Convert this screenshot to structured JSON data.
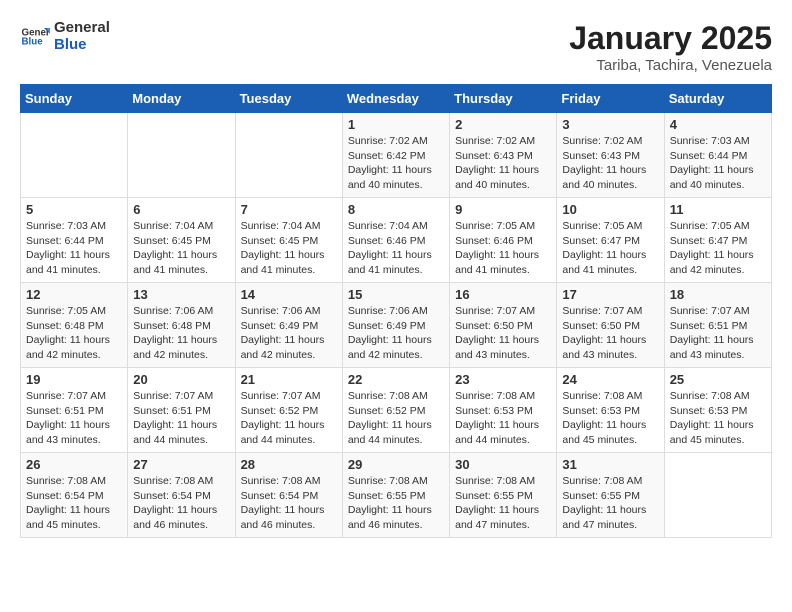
{
  "header": {
    "logo_general": "General",
    "logo_blue": "Blue",
    "title": "January 2025",
    "subtitle": "Tariba, Tachira, Venezuela"
  },
  "weekdays": [
    "Sunday",
    "Monday",
    "Tuesday",
    "Wednesday",
    "Thursday",
    "Friday",
    "Saturday"
  ],
  "weeks": [
    [
      {
        "day": "",
        "info": ""
      },
      {
        "day": "",
        "info": ""
      },
      {
        "day": "",
        "info": ""
      },
      {
        "day": "1",
        "info": "Sunrise: 7:02 AM\nSunset: 6:42 PM\nDaylight: 11 hours and 40 minutes."
      },
      {
        "day": "2",
        "info": "Sunrise: 7:02 AM\nSunset: 6:43 PM\nDaylight: 11 hours and 40 minutes."
      },
      {
        "day": "3",
        "info": "Sunrise: 7:02 AM\nSunset: 6:43 PM\nDaylight: 11 hours and 40 minutes."
      },
      {
        "day": "4",
        "info": "Sunrise: 7:03 AM\nSunset: 6:44 PM\nDaylight: 11 hours and 40 minutes."
      }
    ],
    [
      {
        "day": "5",
        "info": "Sunrise: 7:03 AM\nSunset: 6:44 PM\nDaylight: 11 hours and 41 minutes."
      },
      {
        "day": "6",
        "info": "Sunrise: 7:04 AM\nSunset: 6:45 PM\nDaylight: 11 hours and 41 minutes."
      },
      {
        "day": "7",
        "info": "Sunrise: 7:04 AM\nSunset: 6:45 PM\nDaylight: 11 hours and 41 minutes."
      },
      {
        "day": "8",
        "info": "Sunrise: 7:04 AM\nSunset: 6:46 PM\nDaylight: 11 hours and 41 minutes."
      },
      {
        "day": "9",
        "info": "Sunrise: 7:05 AM\nSunset: 6:46 PM\nDaylight: 11 hours and 41 minutes."
      },
      {
        "day": "10",
        "info": "Sunrise: 7:05 AM\nSunset: 6:47 PM\nDaylight: 11 hours and 41 minutes."
      },
      {
        "day": "11",
        "info": "Sunrise: 7:05 AM\nSunset: 6:47 PM\nDaylight: 11 hours and 42 minutes."
      }
    ],
    [
      {
        "day": "12",
        "info": "Sunrise: 7:05 AM\nSunset: 6:48 PM\nDaylight: 11 hours and 42 minutes."
      },
      {
        "day": "13",
        "info": "Sunrise: 7:06 AM\nSunset: 6:48 PM\nDaylight: 11 hours and 42 minutes."
      },
      {
        "day": "14",
        "info": "Sunrise: 7:06 AM\nSunset: 6:49 PM\nDaylight: 11 hours and 42 minutes."
      },
      {
        "day": "15",
        "info": "Sunrise: 7:06 AM\nSunset: 6:49 PM\nDaylight: 11 hours and 42 minutes."
      },
      {
        "day": "16",
        "info": "Sunrise: 7:07 AM\nSunset: 6:50 PM\nDaylight: 11 hours and 43 minutes."
      },
      {
        "day": "17",
        "info": "Sunrise: 7:07 AM\nSunset: 6:50 PM\nDaylight: 11 hours and 43 minutes."
      },
      {
        "day": "18",
        "info": "Sunrise: 7:07 AM\nSunset: 6:51 PM\nDaylight: 11 hours and 43 minutes."
      }
    ],
    [
      {
        "day": "19",
        "info": "Sunrise: 7:07 AM\nSunset: 6:51 PM\nDaylight: 11 hours and 43 minutes."
      },
      {
        "day": "20",
        "info": "Sunrise: 7:07 AM\nSunset: 6:51 PM\nDaylight: 11 hours and 44 minutes."
      },
      {
        "day": "21",
        "info": "Sunrise: 7:07 AM\nSunset: 6:52 PM\nDaylight: 11 hours and 44 minutes."
      },
      {
        "day": "22",
        "info": "Sunrise: 7:08 AM\nSunset: 6:52 PM\nDaylight: 11 hours and 44 minutes."
      },
      {
        "day": "23",
        "info": "Sunrise: 7:08 AM\nSunset: 6:53 PM\nDaylight: 11 hours and 44 minutes."
      },
      {
        "day": "24",
        "info": "Sunrise: 7:08 AM\nSunset: 6:53 PM\nDaylight: 11 hours and 45 minutes."
      },
      {
        "day": "25",
        "info": "Sunrise: 7:08 AM\nSunset: 6:53 PM\nDaylight: 11 hours and 45 minutes."
      }
    ],
    [
      {
        "day": "26",
        "info": "Sunrise: 7:08 AM\nSunset: 6:54 PM\nDaylight: 11 hours and 45 minutes."
      },
      {
        "day": "27",
        "info": "Sunrise: 7:08 AM\nSunset: 6:54 PM\nDaylight: 11 hours and 46 minutes."
      },
      {
        "day": "28",
        "info": "Sunrise: 7:08 AM\nSunset: 6:54 PM\nDaylight: 11 hours and 46 minutes."
      },
      {
        "day": "29",
        "info": "Sunrise: 7:08 AM\nSunset: 6:55 PM\nDaylight: 11 hours and 46 minutes."
      },
      {
        "day": "30",
        "info": "Sunrise: 7:08 AM\nSunset: 6:55 PM\nDaylight: 11 hours and 47 minutes."
      },
      {
        "day": "31",
        "info": "Sunrise: 7:08 AM\nSunset: 6:55 PM\nDaylight: 11 hours and 47 minutes."
      },
      {
        "day": "",
        "info": ""
      }
    ]
  ]
}
